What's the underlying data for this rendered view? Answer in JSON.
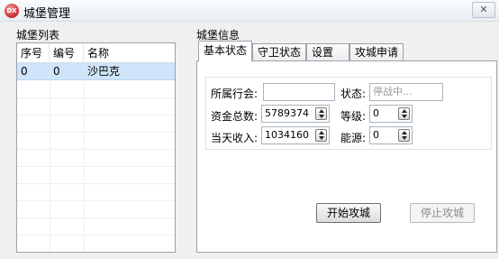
{
  "window": {
    "title": "城堡管理",
    "close_label": "✕"
  },
  "castle_list": {
    "group_label": "城堡列表",
    "columns": [
      "序号",
      "编号",
      "名称"
    ],
    "rows": [
      {
        "index": "0",
        "id": "0",
        "name": "沙巴克"
      }
    ]
  },
  "castle_info": {
    "group_label": "城堡信息",
    "tabs": [
      "基本状态",
      "守卫状态",
      "设置",
      "攻城申请"
    ],
    "active_tab": "基本状态",
    "fields": {
      "guild_label": "所属行会:",
      "guild_value": "",
      "status_label": "状态:",
      "status_value": "停战中...",
      "funds_label": "资金总数:",
      "funds_value": "5789374",
      "level_label": "等级:",
      "level_value": "0",
      "income_label": "当天收入:",
      "income_value": "1034160",
      "energy_label": "能源:",
      "energy_value": "0"
    },
    "buttons": {
      "start_siege": "开始攻城",
      "stop_siege": "停止攻城"
    }
  }
}
